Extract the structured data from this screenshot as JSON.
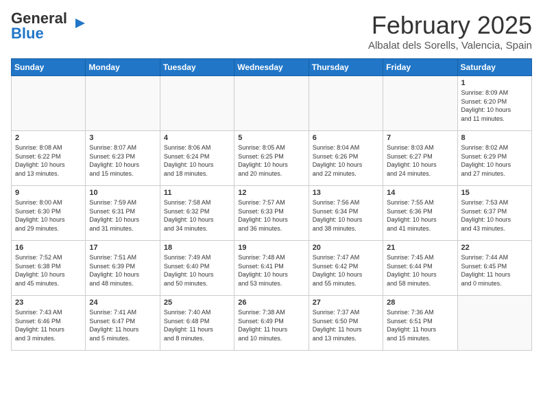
{
  "header": {
    "logo_general": "General",
    "logo_blue": "Blue",
    "month_year": "February 2025",
    "location": "Albalat dels Sorells, Valencia, Spain"
  },
  "days_of_week": [
    "Sunday",
    "Monday",
    "Tuesday",
    "Wednesday",
    "Thursday",
    "Friday",
    "Saturday"
  ],
  "weeks": [
    [
      {
        "day": "",
        "info": ""
      },
      {
        "day": "",
        "info": ""
      },
      {
        "day": "",
        "info": ""
      },
      {
        "day": "",
        "info": ""
      },
      {
        "day": "",
        "info": ""
      },
      {
        "day": "",
        "info": ""
      },
      {
        "day": "1",
        "info": "Sunrise: 8:09 AM\nSunset: 6:20 PM\nDaylight: 10 hours\nand 11 minutes."
      }
    ],
    [
      {
        "day": "2",
        "info": "Sunrise: 8:08 AM\nSunset: 6:22 PM\nDaylight: 10 hours\nand 13 minutes."
      },
      {
        "day": "3",
        "info": "Sunrise: 8:07 AM\nSunset: 6:23 PM\nDaylight: 10 hours\nand 15 minutes."
      },
      {
        "day": "4",
        "info": "Sunrise: 8:06 AM\nSunset: 6:24 PM\nDaylight: 10 hours\nand 18 minutes."
      },
      {
        "day": "5",
        "info": "Sunrise: 8:05 AM\nSunset: 6:25 PM\nDaylight: 10 hours\nand 20 minutes."
      },
      {
        "day": "6",
        "info": "Sunrise: 8:04 AM\nSunset: 6:26 PM\nDaylight: 10 hours\nand 22 minutes."
      },
      {
        "day": "7",
        "info": "Sunrise: 8:03 AM\nSunset: 6:27 PM\nDaylight: 10 hours\nand 24 minutes."
      },
      {
        "day": "8",
        "info": "Sunrise: 8:02 AM\nSunset: 6:29 PM\nDaylight: 10 hours\nand 27 minutes."
      }
    ],
    [
      {
        "day": "9",
        "info": "Sunrise: 8:00 AM\nSunset: 6:30 PM\nDaylight: 10 hours\nand 29 minutes."
      },
      {
        "day": "10",
        "info": "Sunrise: 7:59 AM\nSunset: 6:31 PM\nDaylight: 10 hours\nand 31 minutes."
      },
      {
        "day": "11",
        "info": "Sunrise: 7:58 AM\nSunset: 6:32 PM\nDaylight: 10 hours\nand 34 minutes."
      },
      {
        "day": "12",
        "info": "Sunrise: 7:57 AM\nSunset: 6:33 PM\nDaylight: 10 hours\nand 36 minutes."
      },
      {
        "day": "13",
        "info": "Sunrise: 7:56 AM\nSunset: 6:34 PM\nDaylight: 10 hours\nand 38 minutes."
      },
      {
        "day": "14",
        "info": "Sunrise: 7:55 AM\nSunset: 6:36 PM\nDaylight: 10 hours\nand 41 minutes."
      },
      {
        "day": "15",
        "info": "Sunrise: 7:53 AM\nSunset: 6:37 PM\nDaylight: 10 hours\nand 43 minutes."
      }
    ],
    [
      {
        "day": "16",
        "info": "Sunrise: 7:52 AM\nSunset: 6:38 PM\nDaylight: 10 hours\nand 45 minutes."
      },
      {
        "day": "17",
        "info": "Sunrise: 7:51 AM\nSunset: 6:39 PM\nDaylight: 10 hours\nand 48 minutes."
      },
      {
        "day": "18",
        "info": "Sunrise: 7:49 AM\nSunset: 6:40 PM\nDaylight: 10 hours\nand 50 minutes."
      },
      {
        "day": "19",
        "info": "Sunrise: 7:48 AM\nSunset: 6:41 PM\nDaylight: 10 hours\nand 53 minutes."
      },
      {
        "day": "20",
        "info": "Sunrise: 7:47 AM\nSunset: 6:42 PM\nDaylight: 10 hours\nand 55 minutes."
      },
      {
        "day": "21",
        "info": "Sunrise: 7:45 AM\nSunset: 6:44 PM\nDaylight: 10 hours\nand 58 minutes."
      },
      {
        "day": "22",
        "info": "Sunrise: 7:44 AM\nSunset: 6:45 PM\nDaylight: 11 hours\nand 0 minutes."
      }
    ],
    [
      {
        "day": "23",
        "info": "Sunrise: 7:43 AM\nSunset: 6:46 PM\nDaylight: 11 hours\nand 3 minutes."
      },
      {
        "day": "24",
        "info": "Sunrise: 7:41 AM\nSunset: 6:47 PM\nDaylight: 11 hours\nand 5 minutes."
      },
      {
        "day": "25",
        "info": "Sunrise: 7:40 AM\nSunset: 6:48 PM\nDaylight: 11 hours\nand 8 minutes."
      },
      {
        "day": "26",
        "info": "Sunrise: 7:38 AM\nSunset: 6:49 PM\nDaylight: 11 hours\nand 10 minutes."
      },
      {
        "day": "27",
        "info": "Sunrise: 7:37 AM\nSunset: 6:50 PM\nDaylight: 11 hours\nand 13 minutes."
      },
      {
        "day": "28",
        "info": "Sunrise: 7:36 AM\nSunset: 6:51 PM\nDaylight: 11 hours\nand 15 minutes."
      },
      {
        "day": "",
        "info": ""
      }
    ]
  ]
}
